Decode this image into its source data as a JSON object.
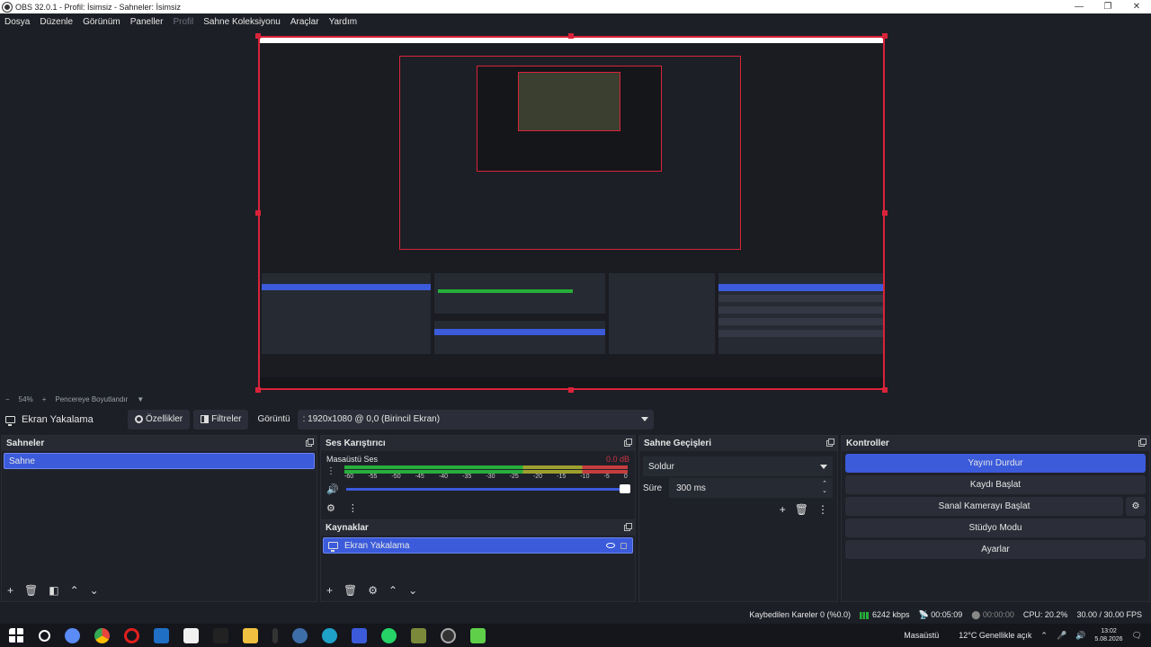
{
  "window": {
    "title": "OBS 32.0.1 - Profil: İsimsiz - Sahneler: İsimsiz"
  },
  "menu": [
    "Dosya",
    "Düzenle",
    "Görünüm",
    "Paneller",
    "Profil",
    "Sahne Koleksiyonu",
    "Araçlar",
    "Yardım"
  ],
  "zoom": {
    "value": "54%",
    "mode": "Pencereye Boyutlandır"
  },
  "source_toolbar": {
    "selected_source": "Ekran Yakalama",
    "properties": "Özellikler",
    "filters": "Filtreler",
    "display_label": "Görüntü",
    "display_value": ": 1920x1080 @ 0,0 (Birincil Ekran)"
  },
  "scenes": {
    "title": "Sahneler",
    "items": [
      "Sahne"
    ]
  },
  "mixer": {
    "title": "Ses Karıştırıcı",
    "channel": "Masaüstü Ses",
    "db": "0.0 dB",
    "ticks": [
      "-60",
      "-55",
      "-50",
      "-45",
      "-40",
      "-35",
      "-30",
      "-25",
      "-20",
      "-15",
      "-10",
      "-5",
      "0"
    ],
    "volume_fraction": 1.0
  },
  "sources": {
    "title": "Kaynaklar",
    "items": [
      "Ekran Yakalama"
    ]
  },
  "transitions": {
    "title": "Sahne Geçişleri",
    "type": "Soldur",
    "duration_label": "Süre",
    "duration": "300 ms"
  },
  "controls": {
    "title": "Kontroller",
    "buttons": [
      "Yayını Durdur",
      "Kaydı Başlat",
      "Sanal Kamerayı Başlat",
      "Stüdyo Modu",
      "Ayarlar"
    ]
  },
  "status": {
    "dropped": "Kaybedilen Kareler 0 (%0.0)",
    "bitrate": "6242 kbps",
    "stream_time": "00:05:09",
    "record_time": "00:00:00",
    "cpu": "CPU: 20.2%",
    "fps": "30.00 / 30.00 FPS"
  },
  "taskbar": {
    "desktop": "Masaüstü",
    "weather": "12°C  Genellikle açık",
    "time": "13:02",
    "date": "5.08.2026"
  },
  "colors": {
    "accent": "#3b5bdb",
    "preview_border": "#d9233a",
    "background": "#1d1f26"
  }
}
